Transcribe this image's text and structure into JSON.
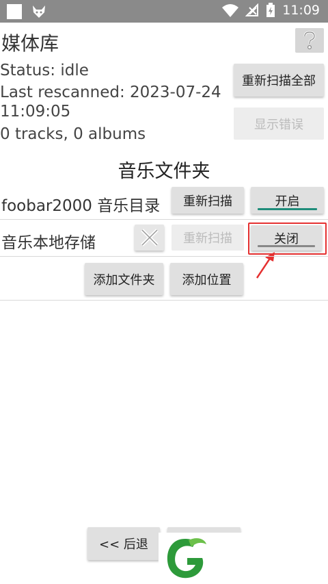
{
  "status_bar": {
    "time": "11:09"
  },
  "header": {
    "title": "媒体库",
    "help_label": "?"
  },
  "library": {
    "status": "Status: idle",
    "last_rescanned_line1": "Last rescanned: 2023-07-24",
    "last_rescanned_line2": "11:09:05",
    "counts": "0 tracks, 0 albums",
    "rescan_all_label": "重新扫描全部",
    "show_errors_label": "显示错误"
  },
  "folders": {
    "section_title": "音乐文件夹",
    "items": [
      {
        "name": "foobar2000 音乐目录",
        "rescan_label": "重新扫描",
        "toggle_label": "开启"
      },
      {
        "name": "音乐本地存储",
        "rescan_label": "重新扫描",
        "toggle_label": "关闭"
      }
    ],
    "add_folder_label": "添加文件夹",
    "add_location_label": "添加位置"
  },
  "nav": {
    "back_label": "<< 后退"
  },
  "colors": {
    "status_bar": "#8a8a8a",
    "accent_teal": "#1f8c7a",
    "highlight": "#e53030",
    "logo_green": "#2d9a3a"
  }
}
